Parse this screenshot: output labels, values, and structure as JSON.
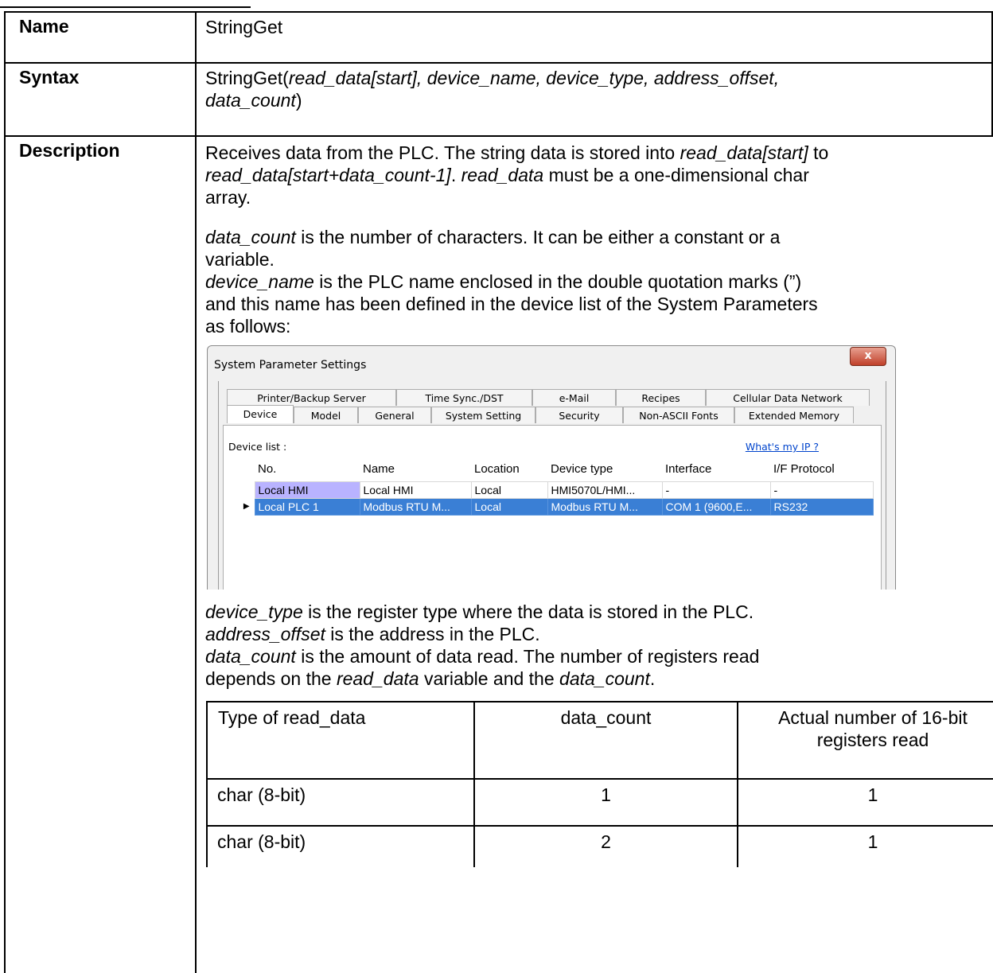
{
  "rows": {
    "name": {
      "label": "Name",
      "value": "StringGet"
    },
    "syntax": {
      "label": "Syntax",
      "func": "StringGet(",
      "args1": "read_data[start], device_name, device_type, address_offset,",
      "args2": "data_count",
      "close": ")"
    },
    "description": {
      "label": "Description",
      "p1": {
        "t1": "Receives data from the PLC. The string data is stored into ",
        "i1": "read_data[start]",
        "t2": " to",
        "i2": "read_data[start+data_count-1]",
        "t3": ". ",
        "i3": "read_data",
        "t4": " must be a one-dimensional char",
        "t5": "array."
      },
      "p2": {
        "i1": "data_count",
        "t1": " is the number of characters. It can be either a constant or a",
        "t2": "variable.",
        "i2": "device_name",
        "t3": " is the PLC name enclosed in the double quotation marks (”)",
        "t4": "and this name has been defined in the device list of the System Parameters",
        "t5": "as follows:"
      },
      "p3": {
        "i1": "device_type",
        "t1": " is the register type where the data is stored in the PLC.",
        "i2": "address_offset",
        "t2": " is the address in the PLC.",
        "i3": "data_count",
        "t3": " is the amount of data read. The number of registers read",
        "t4": "depends on the ",
        "i4": "read_data",
        "t5": " variable and the ",
        "i5": "data_count",
        "t6": "."
      }
    }
  },
  "dialog": {
    "title": "System Parameter Settings",
    "close": "x",
    "tabs_row1": [
      "Printer/Backup Server",
      "Time Sync./DST",
      "e-Mail",
      "Recipes",
      "Cellular Data Network"
    ],
    "tabs_row2": [
      "Device",
      "Model",
      "General",
      "System Setting",
      "Security",
      "Non-ASCII Fonts",
      "Extended Memory"
    ],
    "device_list_label": "Device list :",
    "ip_link": "What's my IP ?",
    "columns": [
      "No.",
      "Name",
      "Location",
      "Device type",
      "Interface",
      "I/F Protocol"
    ],
    "devices": [
      [
        "Local HMI",
        "Local HMI",
        "Local",
        "HMI5070L/HMI...",
        "-",
        "-"
      ],
      [
        "Local PLC 1",
        "Modbus RTU M...",
        "Local",
        "Modbus RTU M...",
        "COM 1 (9600,E...",
        "RS232"
      ]
    ],
    "selected_indicator": "▶"
  },
  "data_table": {
    "headers": [
      "Type of read_data",
      "data_count",
      "Actual number of 16-bit",
      "registers read"
    ],
    "rows": [
      [
        "char (8-bit)",
        "1",
        "1"
      ],
      [
        "char (8-bit)",
        "2",
        "1"
      ]
    ]
  }
}
